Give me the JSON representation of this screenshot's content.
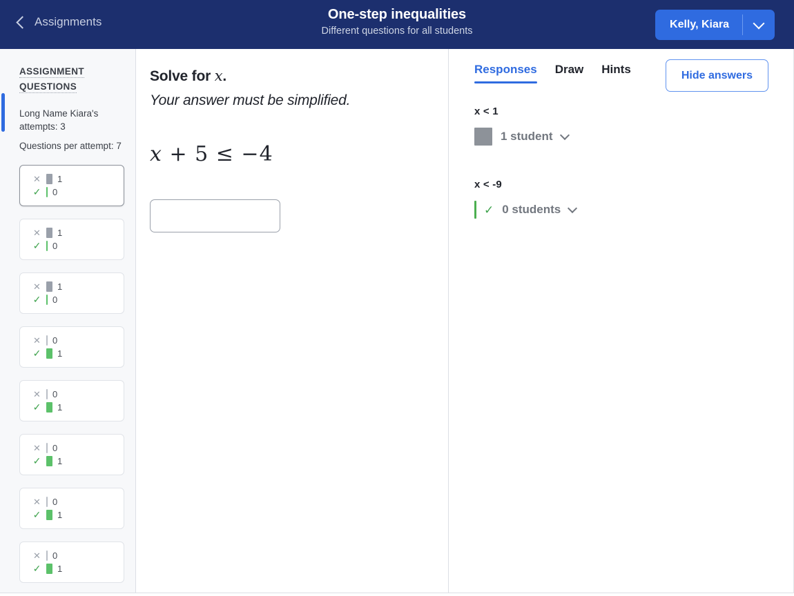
{
  "header": {
    "back_label": "Assignments",
    "back_icon": "chevron-left-icon",
    "title": "One-step inequalities",
    "subtitle": "Different questions for all students",
    "student_name": "Kelly, Kiara",
    "dropdown_icon": "chevron-down-icon",
    "accent_blue": "#2f6be0",
    "navy": "#1c2f6e"
  },
  "sidebar": {
    "section_title_line1": "ASSIGNMENT",
    "section_title_line2": "QUESTIONS",
    "attempts_text": "Long Name Kiara's attempts: 3",
    "questions_per_attempt_text": "Questions per attempt: 7",
    "cards": [
      {
        "incorrect": "1",
        "correct": "0",
        "incorrect_bar": "full",
        "correct_bar": "empty",
        "selected": true
      },
      {
        "incorrect": "1",
        "correct": "0",
        "incorrect_bar": "full",
        "correct_bar": "empty",
        "selected": false
      },
      {
        "incorrect": "1",
        "correct": "0",
        "incorrect_bar": "full",
        "correct_bar": "empty",
        "selected": false
      },
      {
        "incorrect": "0",
        "correct": "1",
        "incorrect_bar": "empty",
        "correct_bar": "full",
        "selected": false
      },
      {
        "incorrect": "0",
        "correct": "1",
        "incorrect_bar": "empty",
        "correct_bar": "full",
        "selected": false
      },
      {
        "incorrect": "0",
        "correct": "1",
        "incorrect_bar": "empty",
        "correct_bar": "full",
        "selected": false
      },
      {
        "incorrect": "0",
        "correct": "1",
        "incorrect_bar": "empty",
        "correct_bar": "full",
        "selected": false
      },
      {
        "incorrect": "0",
        "correct": "1",
        "incorrect_bar": "empty",
        "correct_bar": "full",
        "selected": false
      }
    ]
  },
  "question": {
    "prompt_prefix": "Solve for ",
    "prompt_variable": "x",
    "prompt_suffix": ".",
    "instruction": "Your answer must be simplified.",
    "equation_variable": "x",
    "equation_rest": " + 5 ≤ −4",
    "answer_value": "",
    "answer_placeholder": ""
  },
  "responses": {
    "tabs": [
      {
        "label": "Responses",
        "active": true
      },
      {
        "label": "Draw",
        "active": false
      },
      {
        "label": "Hints",
        "active": false
      }
    ],
    "hide_answers_label": "Hide answers",
    "groups": [
      {
        "answer": "x < 1",
        "count_label": "1 student",
        "bar_style": "gray-full",
        "show_check": false,
        "caret_icon": "chevron-down-icon"
      },
      {
        "answer": "x < -9",
        "count_label": "0 students",
        "bar_style": "green-empty",
        "show_check": true,
        "check_icon": "check-icon",
        "caret_icon": "chevron-down-icon"
      }
    ]
  }
}
